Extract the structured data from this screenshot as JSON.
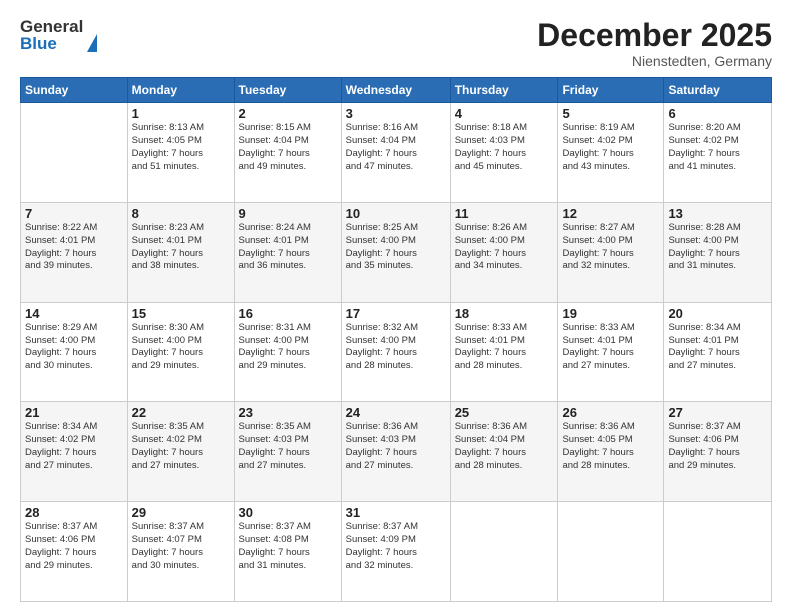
{
  "header": {
    "logo_line1": "General",
    "logo_line2": "Blue",
    "month": "December 2025",
    "location": "Nienstedten, Germany"
  },
  "days_of_week": [
    "Sunday",
    "Monday",
    "Tuesday",
    "Wednesday",
    "Thursday",
    "Friday",
    "Saturday"
  ],
  "weeks": [
    [
      {
        "day": "",
        "info": ""
      },
      {
        "day": "1",
        "info": "Sunrise: 8:13 AM\nSunset: 4:05 PM\nDaylight: 7 hours\nand 51 minutes."
      },
      {
        "day": "2",
        "info": "Sunrise: 8:15 AM\nSunset: 4:04 PM\nDaylight: 7 hours\nand 49 minutes."
      },
      {
        "day": "3",
        "info": "Sunrise: 8:16 AM\nSunset: 4:04 PM\nDaylight: 7 hours\nand 47 minutes."
      },
      {
        "day": "4",
        "info": "Sunrise: 8:18 AM\nSunset: 4:03 PM\nDaylight: 7 hours\nand 45 minutes."
      },
      {
        "day": "5",
        "info": "Sunrise: 8:19 AM\nSunset: 4:02 PM\nDaylight: 7 hours\nand 43 minutes."
      },
      {
        "day": "6",
        "info": "Sunrise: 8:20 AM\nSunset: 4:02 PM\nDaylight: 7 hours\nand 41 minutes."
      }
    ],
    [
      {
        "day": "7",
        "info": "Sunrise: 8:22 AM\nSunset: 4:01 PM\nDaylight: 7 hours\nand 39 minutes."
      },
      {
        "day": "8",
        "info": "Sunrise: 8:23 AM\nSunset: 4:01 PM\nDaylight: 7 hours\nand 38 minutes."
      },
      {
        "day": "9",
        "info": "Sunrise: 8:24 AM\nSunset: 4:01 PM\nDaylight: 7 hours\nand 36 minutes."
      },
      {
        "day": "10",
        "info": "Sunrise: 8:25 AM\nSunset: 4:00 PM\nDaylight: 7 hours\nand 35 minutes."
      },
      {
        "day": "11",
        "info": "Sunrise: 8:26 AM\nSunset: 4:00 PM\nDaylight: 7 hours\nand 34 minutes."
      },
      {
        "day": "12",
        "info": "Sunrise: 8:27 AM\nSunset: 4:00 PM\nDaylight: 7 hours\nand 32 minutes."
      },
      {
        "day": "13",
        "info": "Sunrise: 8:28 AM\nSunset: 4:00 PM\nDaylight: 7 hours\nand 31 minutes."
      }
    ],
    [
      {
        "day": "14",
        "info": "Sunrise: 8:29 AM\nSunset: 4:00 PM\nDaylight: 7 hours\nand 30 minutes."
      },
      {
        "day": "15",
        "info": "Sunrise: 8:30 AM\nSunset: 4:00 PM\nDaylight: 7 hours\nand 29 minutes."
      },
      {
        "day": "16",
        "info": "Sunrise: 8:31 AM\nSunset: 4:00 PM\nDaylight: 7 hours\nand 29 minutes."
      },
      {
        "day": "17",
        "info": "Sunrise: 8:32 AM\nSunset: 4:00 PM\nDaylight: 7 hours\nand 28 minutes."
      },
      {
        "day": "18",
        "info": "Sunrise: 8:33 AM\nSunset: 4:01 PM\nDaylight: 7 hours\nand 28 minutes."
      },
      {
        "day": "19",
        "info": "Sunrise: 8:33 AM\nSunset: 4:01 PM\nDaylight: 7 hours\nand 27 minutes."
      },
      {
        "day": "20",
        "info": "Sunrise: 8:34 AM\nSunset: 4:01 PM\nDaylight: 7 hours\nand 27 minutes."
      }
    ],
    [
      {
        "day": "21",
        "info": "Sunrise: 8:34 AM\nSunset: 4:02 PM\nDaylight: 7 hours\nand 27 minutes."
      },
      {
        "day": "22",
        "info": "Sunrise: 8:35 AM\nSunset: 4:02 PM\nDaylight: 7 hours\nand 27 minutes."
      },
      {
        "day": "23",
        "info": "Sunrise: 8:35 AM\nSunset: 4:03 PM\nDaylight: 7 hours\nand 27 minutes."
      },
      {
        "day": "24",
        "info": "Sunrise: 8:36 AM\nSunset: 4:03 PM\nDaylight: 7 hours\nand 27 minutes."
      },
      {
        "day": "25",
        "info": "Sunrise: 8:36 AM\nSunset: 4:04 PM\nDaylight: 7 hours\nand 28 minutes."
      },
      {
        "day": "26",
        "info": "Sunrise: 8:36 AM\nSunset: 4:05 PM\nDaylight: 7 hours\nand 28 minutes."
      },
      {
        "day": "27",
        "info": "Sunrise: 8:37 AM\nSunset: 4:06 PM\nDaylight: 7 hours\nand 29 minutes."
      }
    ],
    [
      {
        "day": "28",
        "info": "Sunrise: 8:37 AM\nSunset: 4:06 PM\nDaylight: 7 hours\nand 29 minutes."
      },
      {
        "day": "29",
        "info": "Sunrise: 8:37 AM\nSunset: 4:07 PM\nDaylight: 7 hours\nand 30 minutes."
      },
      {
        "day": "30",
        "info": "Sunrise: 8:37 AM\nSunset: 4:08 PM\nDaylight: 7 hours\nand 31 minutes."
      },
      {
        "day": "31",
        "info": "Sunrise: 8:37 AM\nSunset: 4:09 PM\nDaylight: 7 hours\nand 32 minutes."
      },
      {
        "day": "",
        "info": ""
      },
      {
        "day": "",
        "info": ""
      },
      {
        "day": "",
        "info": ""
      }
    ]
  ]
}
